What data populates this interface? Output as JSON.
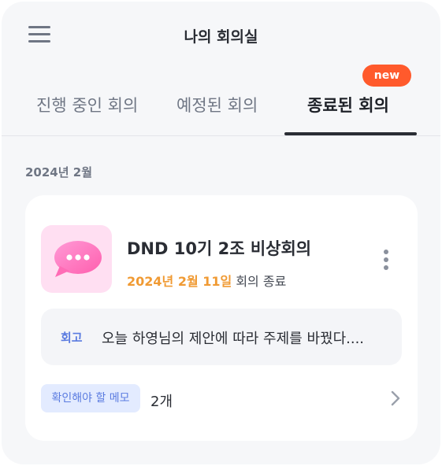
{
  "header": {
    "title": "나의 회의실"
  },
  "tabs": [
    {
      "label": "진행 중인 회의",
      "active": false
    },
    {
      "label": "예정된 회의",
      "active": false
    },
    {
      "label": "종료된 회의",
      "active": true
    }
  ],
  "badge": {
    "label": "new"
  },
  "section": {
    "date": "2024년 2월"
  },
  "card": {
    "icon": "chat-bubble-icon",
    "title": "DND 10기 2조 비상회의",
    "date": "2024년 2월 11일",
    "status": " 회의 종료",
    "retro_tag": "회고",
    "retro_text": "오늘 하영님의 제안에 따라 주제를 바꿨다....",
    "memo_label": "확인해야 할 메모",
    "memo_count": "2개"
  },
  "colors": {
    "accent_orange": "#f09a33",
    "badge_red": "#ff5a2c",
    "memo_blue": "#5a7be0",
    "icon_pink": "#ff7fc4"
  }
}
